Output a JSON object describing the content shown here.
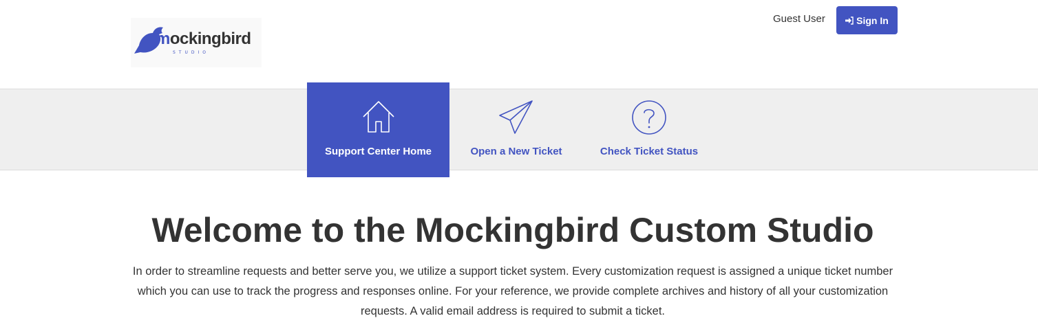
{
  "header": {
    "logo": {
      "word_first": "m",
      "word_rest": "ockingbird",
      "sub": "STUDIO"
    },
    "guest_label": "Guest User",
    "signin_label": "Sign In",
    "signin_icon": "sign-in-icon"
  },
  "nav": {
    "items": [
      {
        "label": "Support Center Home",
        "icon": "home-icon",
        "active": true
      },
      {
        "label": "Open a New Ticket",
        "icon": "paper-plane-icon",
        "active": false
      },
      {
        "label": "Check Ticket Status",
        "icon": "question-circle-icon",
        "active": false
      }
    ]
  },
  "main": {
    "title": "Welcome to the Mockingbird Custom Studio",
    "intro": "In order to streamline requests and better serve you, we utilize a support ticket system. Every customization request is assigned a unique ticket number which you can use to track the progress and responses online. For your reference, we provide complete archives and history of all your customization requests. A valid email address is required to submit a ticket."
  },
  "colors": {
    "accent": "#4254c1",
    "nav_bg": "#efefef",
    "text": "#333333"
  }
}
